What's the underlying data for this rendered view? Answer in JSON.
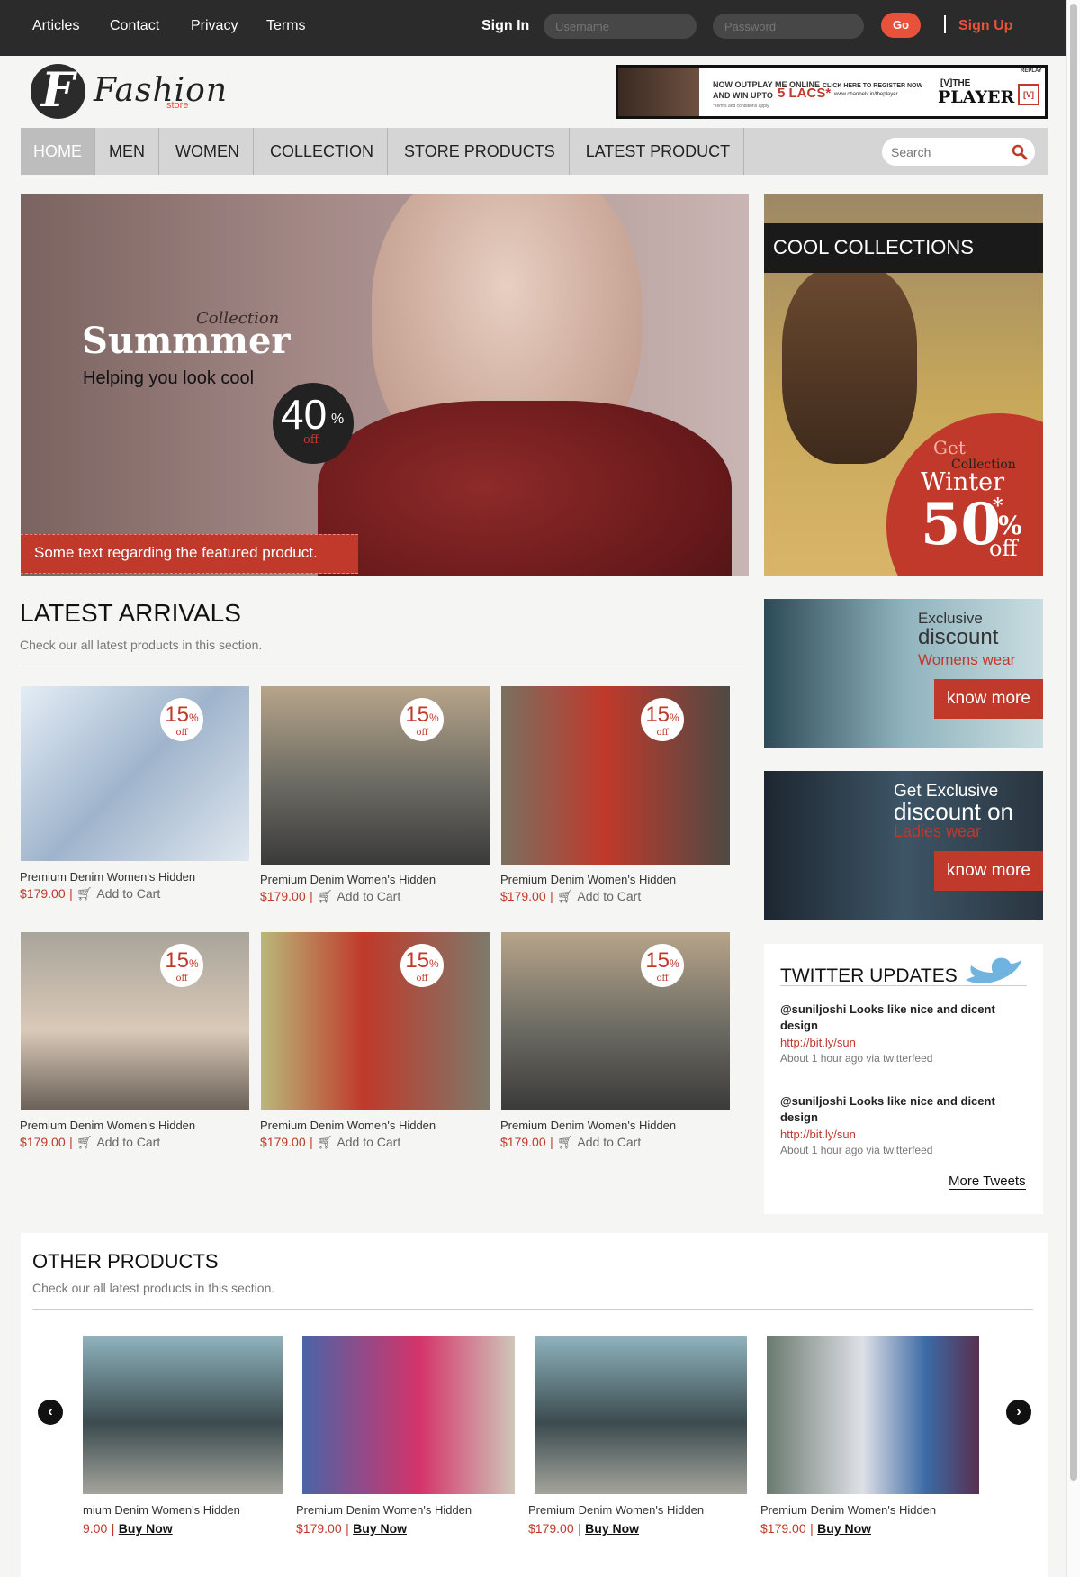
{
  "topbar": {
    "links": [
      "Articles",
      "Contact",
      "Privacy",
      "Terms"
    ],
    "signin_label": "Sign In",
    "username_placeholder": "Username",
    "password_placeholder": "Password",
    "go_label": "Go",
    "signup_label": "Sign Up"
  },
  "brand": {
    "initial": "F",
    "name": "Fashion",
    "sub": "store"
  },
  "ad": {
    "line1": "NOW OUTPLAY ME ONLINE",
    "line2": "AND WIN UPTO",
    "amount": "5 LACS*",
    "cta1": "CLICK HERE TO REGISTER NOW",
    "cta2": "www.channelv.in/theplayer",
    "fine": "*Terms and conditions apply",
    "badge_top": "REPLAY",
    "brand_small": "[V]THE",
    "brand_big": "PLAYER",
    "logo": "[V]"
  },
  "nav": {
    "items": [
      "HOME",
      "MEN",
      "WOMEN",
      "COLLECTION",
      "STORE PRODUCTS",
      "LATEST PRODUCT"
    ],
    "search_placeholder": "Search"
  },
  "hero": {
    "kicker": "Collection",
    "title": "Summmer",
    "tagline": "Helping you look cool",
    "discount": "40",
    "pct": "%",
    "off": "off",
    "caption": "Some text regarding the featured product."
  },
  "cool": {
    "title": "COOL COLLECTIONS",
    "get": "Get",
    "collection": "Collection",
    "winter": "Winter",
    "discount": "50",
    "star": "*",
    "pct": "%",
    "off": "off"
  },
  "latest": {
    "title": "LATEST ARRIVALS",
    "subtitle": "Check our all latest products in this section.",
    "badge_value": "15",
    "badge_pct": "%",
    "badge_off": "off",
    "products": [
      {
        "name": "Premium Denim Women's Hidden",
        "price": "$179.00",
        "action": "Add to Cart"
      },
      {
        "name": "Premium Denim Women's Hidden",
        "price": "$179.00",
        "action": "Add to Cart"
      },
      {
        "name": "Premium Denim Women's Hidden",
        "price": "$179.00",
        "action": "Add to Cart"
      },
      {
        "name": "Premium Denim Women's Hidden",
        "price": "$179.00",
        "action": "Add to Cart"
      },
      {
        "name": "Premium Denim Women's Hidden",
        "price": "$179.00",
        "action": "Add to Cart"
      },
      {
        "name": "Premium Denim Women's Hidden",
        "price": "$179.00",
        "action": "Add to Cart"
      }
    ]
  },
  "promo1": {
    "line1": "Exclusive",
    "line2": "discount",
    "line3": "Womens wear",
    "button": "know more"
  },
  "promo2": {
    "line1": "Get Exclusive",
    "line2": "discount on",
    "line3": "Ladies wear",
    "button": "know more"
  },
  "twitter": {
    "title": "TWITTER UPDATES",
    "tweets": [
      {
        "text": "@suniljoshi Looks like nice and dicent design",
        "link": "http://bit.ly/sun",
        "meta": "About 1 hour ago via twitterfeed"
      },
      {
        "text": "@suniljoshi Looks like nice and dicent design",
        "link": "http://bit.ly/sun",
        "meta": "About 1 hour ago via twitterfeed"
      }
    ],
    "more": "More Tweets"
  },
  "other": {
    "title": "OTHER PRODUCTS",
    "subtitle": "Check our all latest products in this section.",
    "products": [
      {
        "name": "mium Denim Women's Hidden",
        "price": "9.00",
        "action": "Buy Now"
      },
      {
        "name": "Premium Denim Women's Hidden",
        "price": "$179.00",
        "action": "Buy Now"
      },
      {
        "name": "Premium Denim Women's Hidden",
        "price": "$179.00",
        "action": "Buy Now"
      },
      {
        "name": "Premium Denim Women's Hidden",
        "price": "$179.00",
        "action": "Buy Now"
      }
    ],
    "sep": "|"
  },
  "colors": {
    "accent": "#c0392b",
    "topbar": "#2b2b2b",
    "nav": "#d5d5d5"
  }
}
